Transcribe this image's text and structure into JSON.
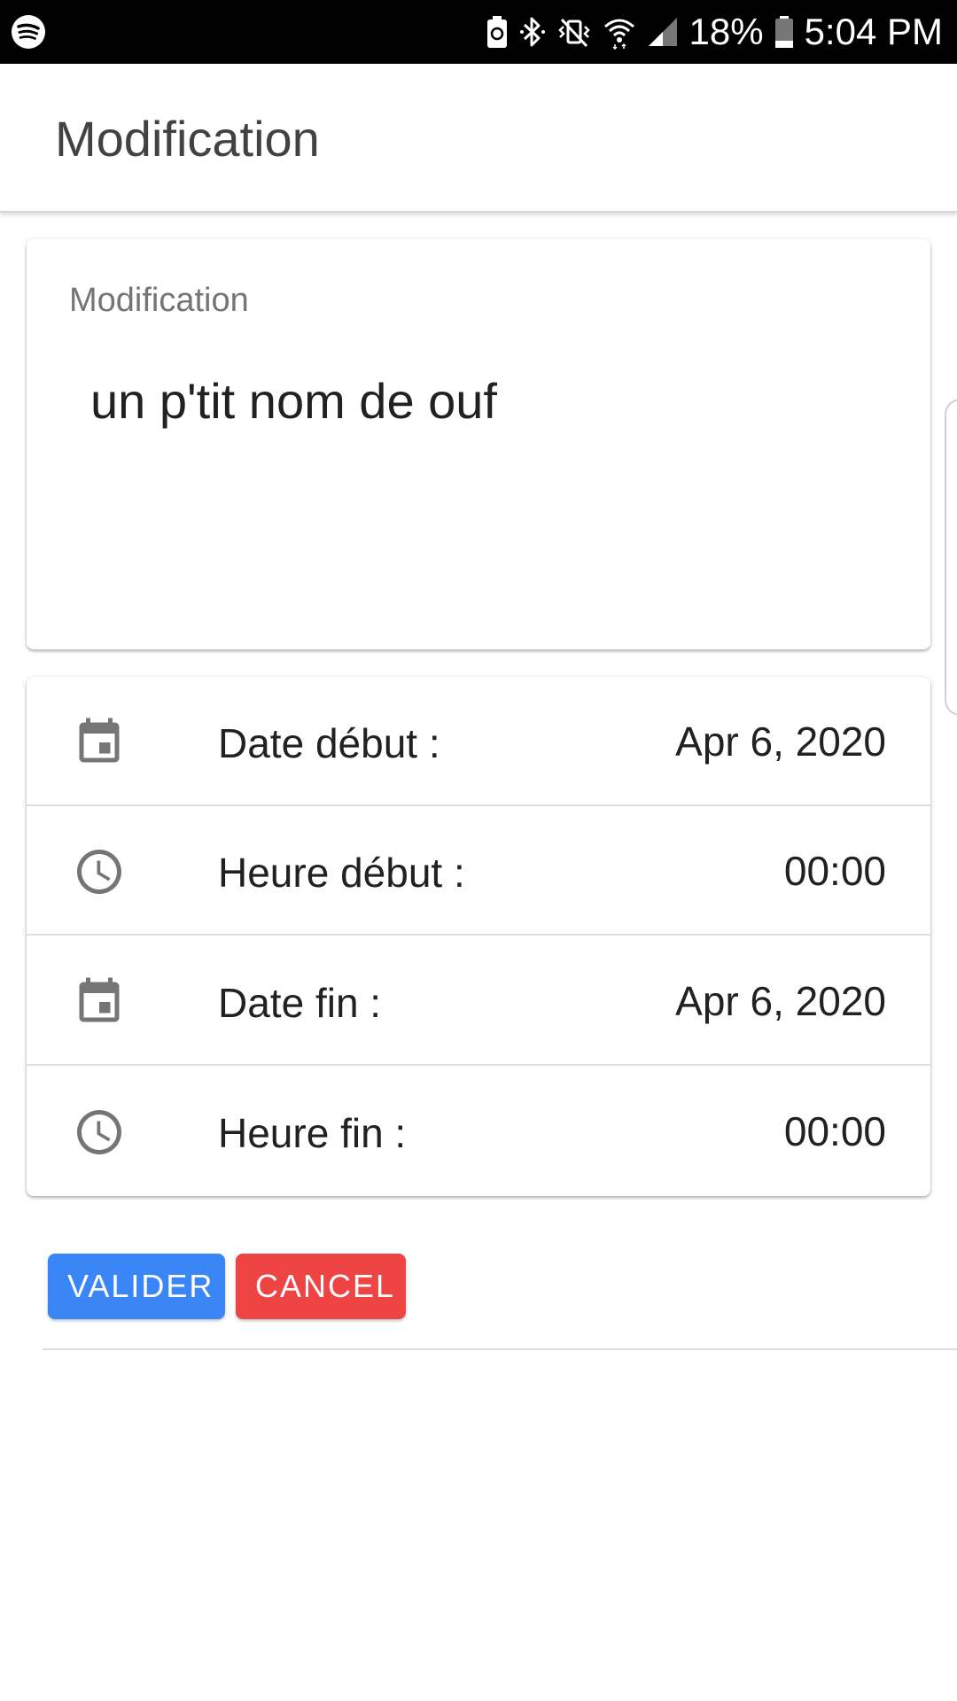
{
  "status_bar": {
    "battery_percent": "18%",
    "time": "5:04 PM",
    "icons": [
      "spotify-icon",
      "battery-saver-icon",
      "bluetooth-icon",
      "vibrate-mute-icon",
      "wifi-icon",
      "cell-signal-icon",
      "battery-icon"
    ]
  },
  "app_bar": {
    "title": "Modification"
  },
  "name_field": {
    "label": "Modification",
    "value": "un p'tit nom de ouf"
  },
  "schedule": {
    "rows": [
      {
        "icon": "calendar-icon",
        "label": "Date début :",
        "value": "Apr 6, 2020"
      },
      {
        "icon": "clock-icon",
        "label": "Heure début :",
        "value": "00:00"
      },
      {
        "icon": "calendar-icon",
        "label": "Date fin :",
        "value": "Apr 6, 2020"
      },
      {
        "icon": "clock-icon",
        "label": "Heure fin :",
        "value": "00:00"
      }
    ]
  },
  "actions": {
    "validate_label": "VALIDER",
    "cancel_label": "CANCEL"
  },
  "colors": {
    "validate": "#3a86f7",
    "cancel": "#ee4444",
    "icon_grey": "#757575"
  }
}
